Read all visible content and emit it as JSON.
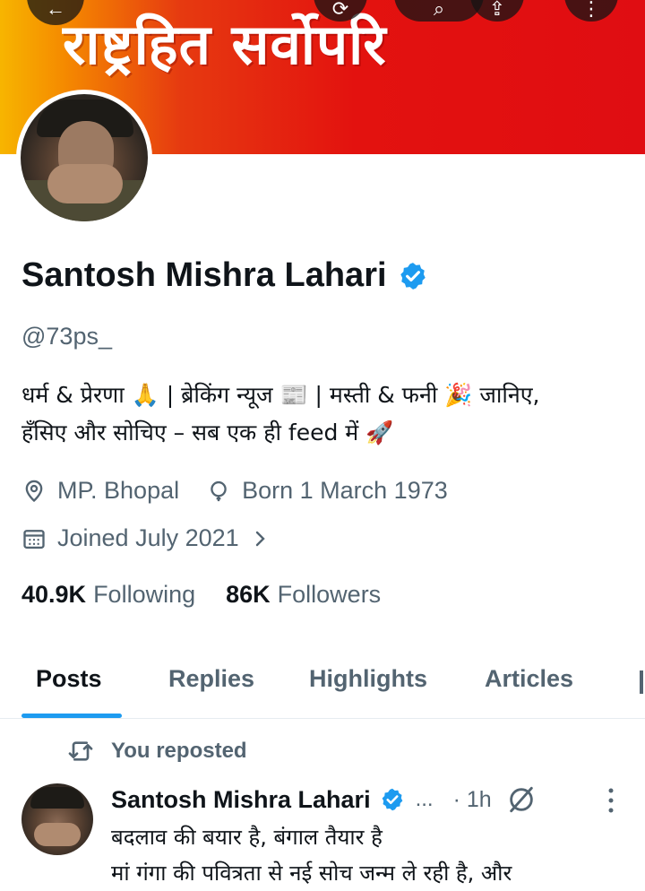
{
  "banner": {
    "text": "राष्ट्रहित सर्वोपरि"
  },
  "profile": {
    "name": "Santosh Mishra Lahari",
    "handle": "@73ps_",
    "bio_line1": "धर्म & प्रेरणा 🙏 | ब्रेकिंग न्यूज 📰 | मस्ती & फनी 🎉  जानिए,",
    "bio_line2": "हँसिए और सोचिए – सब एक ही feed में 🚀",
    "location": "MP. Bhopal",
    "birthday": "Born 1 March 1973",
    "joined": "Joined July 2021",
    "following_count": "40.9K",
    "following_label": "Following",
    "followers_count": "86K",
    "followers_label": "Followers"
  },
  "tabs": [
    {
      "label": "Posts",
      "active": true
    },
    {
      "label": "Replies",
      "active": false
    },
    {
      "label": "Highlights",
      "active": false
    },
    {
      "label": "Articles",
      "active": false
    }
  ],
  "post": {
    "repost_label": "You reposted",
    "author": "Santosh Mishra Lahari",
    "ellipsis": "...",
    "time": "· 1h",
    "line1": "बदलाव की बयार है, बंगाल तैयार है",
    "line2": "मां गंगा की पवित्रता से नई सोच जन्म ले रही है, और"
  },
  "colors": {
    "accent": "#1d9bf0",
    "text_primary": "#0f1419",
    "text_secondary": "#536471",
    "banner_red": "#e3120f",
    "banner_yellow": "#f7b500"
  },
  "icons": [
    "back-icon",
    "grok-icon",
    "search-icon",
    "share-icon",
    "more-icon",
    "verified-badge-icon",
    "location-icon",
    "birthday-icon",
    "calendar-icon",
    "chevron-right-icon",
    "repost-icon"
  ]
}
